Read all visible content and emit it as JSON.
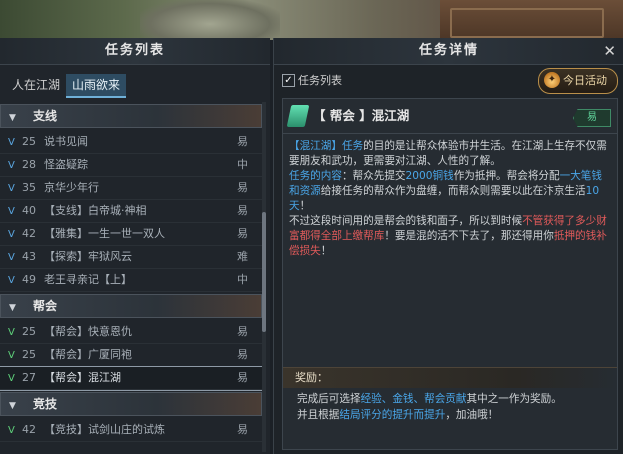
{
  "left_panel": {
    "title": "任务列表",
    "tabs": [
      "人在江湖",
      "山雨欲来"
    ],
    "active_tab": 1,
    "categories": [
      {
        "label": "支线",
        "items": [
          {
            "level": "25",
            "name": "说书见闻",
            "difficulty": "易"
          },
          {
            "level": "28",
            "name": "怪盗疑踪",
            "difficulty": "中"
          },
          {
            "level": "35",
            "name": "京华少年行",
            "difficulty": "易"
          },
          {
            "level": "40",
            "name": "【支线】白帝城·神相",
            "difficulty": "易"
          },
          {
            "level": "42",
            "name": "【雅集】一生一世一双人",
            "difficulty": "易"
          },
          {
            "level": "43",
            "name": "【探索】牢狱风云",
            "difficulty": "难"
          },
          {
            "level": "49",
            "name": "老王寻亲记【上】",
            "difficulty": "中"
          }
        ]
      },
      {
        "label": "帮会",
        "items": [
          {
            "level": "25",
            "name": "【帮会】快意恩仇",
            "difficulty": "易"
          },
          {
            "level": "25",
            "name": "【帮会】广厦同袍",
            "difficulty": "易"
          },
          {
            "level": "27",
            "name": "【帮会】混江湖",
            "difficulty": "易"
          }
        ]
      },
      {
        "label": "竞技",
        "items": [
          {
            "level": "42",
            "name": "【竞技】试剑山庄的试炼",
            "difficulty": "易"
          }
        ]
      }
    ]
  },
  "right_panel": {
    "title": "任务详情",
    "close_icon": "✕",
    "checkbox_label": "任务列表",
    "today_button": "今日活动",
    "quest": {
      "title": "【 帮会 】混江湖",
      "difficulty": "易",
      "desc": {
        "p1_a": "【混江湖】任务",
        "p1_b": "的目的是让帮众体验市井生活。在江湖上生存不仅需要朋友和武功，更需要对江湖、人性的了解。",
        "p2_a": "任务的内容",
        "p2_b": "：帮众先提交",
        "p2_c": "2000铜钱",
        "p2_d": "作为抵押。帮会将分配",
        "p2_e": "一大笔钱和资源",
        "p2_f": "给接任务的帮众作为盘缠，而帮众则需要以此在汴京生活",
        "p2_g": "10天",
        "p2_h": "！",
        "p3_a": "不过这段时间用的是帮会的钱和面子，所以到时候",
        "p3_b": "不管获得了多少财富都得全部上缴帮库",
        "p3_c": "！要是混的活不下去了，那还得用你",
        "p3_d": "抵押的钱补偿损失",
        "p3_e": "！"
      },
      "reward_label": "奖励：",
      "reward": {
        "a": "完成后可选择",
        "b": "经验、金钱、帮会贡献",
        "c": "其中之一作为奖励。",
        "d": "并且根据",
        "e": "结局评分的提升而提升",
        "f": "，加油哦！"
      }
    }
  }
}
